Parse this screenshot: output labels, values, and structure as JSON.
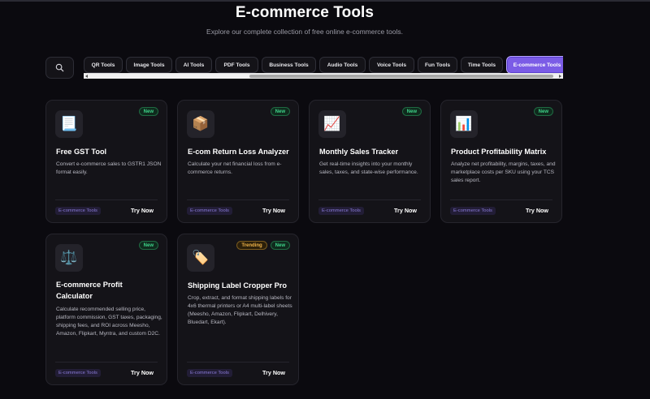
{
  "header": {
    "title": "E-commerce Tools",
    "subtitle": "Explore our complete collection of free online e-commerce tools."
  },
  "tabs": [
    {
      "label": "QR Tools"
    },
    {
      "label": "Image Tools"
    },
    {
      "label": "AI Tools"
    },
    {
      "label": "PDF Tools"
    },
    {
      "label": "Business Tools"
    },
    {
      "label": "Audio Tools"
    },
    {
      "label": "Voice Tools"
    },
    {
      "label": "Fun Tools"
    },
    {
      "label": "Time Tools"
    },
    {
      "label": "E-commerce Tools",
      "active": true
    }
  ],
  "cards": [
    {
      "title": "Free GST Tool",
      "description": "Convert e-commerce sales to GSTR1 JSON format easily.",
      "icon": "document-icon",
      "glyph": "📃",
      "badges": [
        "New"
      ],
      "tag": "E-commerce Tools",
      "action": "Try Now"
    },
    {
      "title": "E-com Return Loss Analyzer",
      "description": "Calculate your net financial loss from e-commerce returns.",
      "icon": "package-icon",
      "glyph": "📦",
      "badges": [
        "New"
      ],
      "tag": "E-commerce Tools",
      "action": "Try Now"
    },
    {
      "title": "Monthly Sales Tracker",
      "description": "Get real-time insights into your monthly sales, taxes, and state-wise performance.",
      "icon": "chart-up-icon",
      "glyph": "📈",
      "badges": [
        "New"
      ],
      "tag": "E-commerce Tools",
      "action": "Try Now"
    },
    {
      "title": "Product Profitability Matrix",
      "description": "Analyze net profitability, margins, taxes, and marketplace costs per SKU using your TCS sales report.",
      "icon": "bar-chart-icon",
      "glyph": "📊",
      "badges": [
        "New"
      ],
      "tag": "E-commerce Tools",
      "action": "Try Now"
    },
    {
      "title": "E-commerce Profit Calculator",
      "description": "Calculate recommended selling price, platform commission, GST taxes, packaging, shipping fees, and ROI across Meesho, Amazon, Flipkart, Myntra, and custom D2C.",
      "icon": "scales-icon",
      "glyph": "⚖️",
      "badges": [
        "New"
      ],
      "tag": "E-commerce Tools",
      "action": "Try Now"
    },
    {
      "title": "Shipping Label Cropper Pro",
      "description": "Crop, extract, and format shipping labels for 4x6 thermal printers or A4 multi-label sheets (Meesho, Amazon, Flipkart, Delhivery, Bluedart, Ekart).",
      "icon": "label-tag-icon",
      "glyph": "🏷️",
      "badges": [
        "Trending",
        "New"
      ],
      "tag": "E-commerce Tools",
      "action": "Try Now"
    }
  ]
}
